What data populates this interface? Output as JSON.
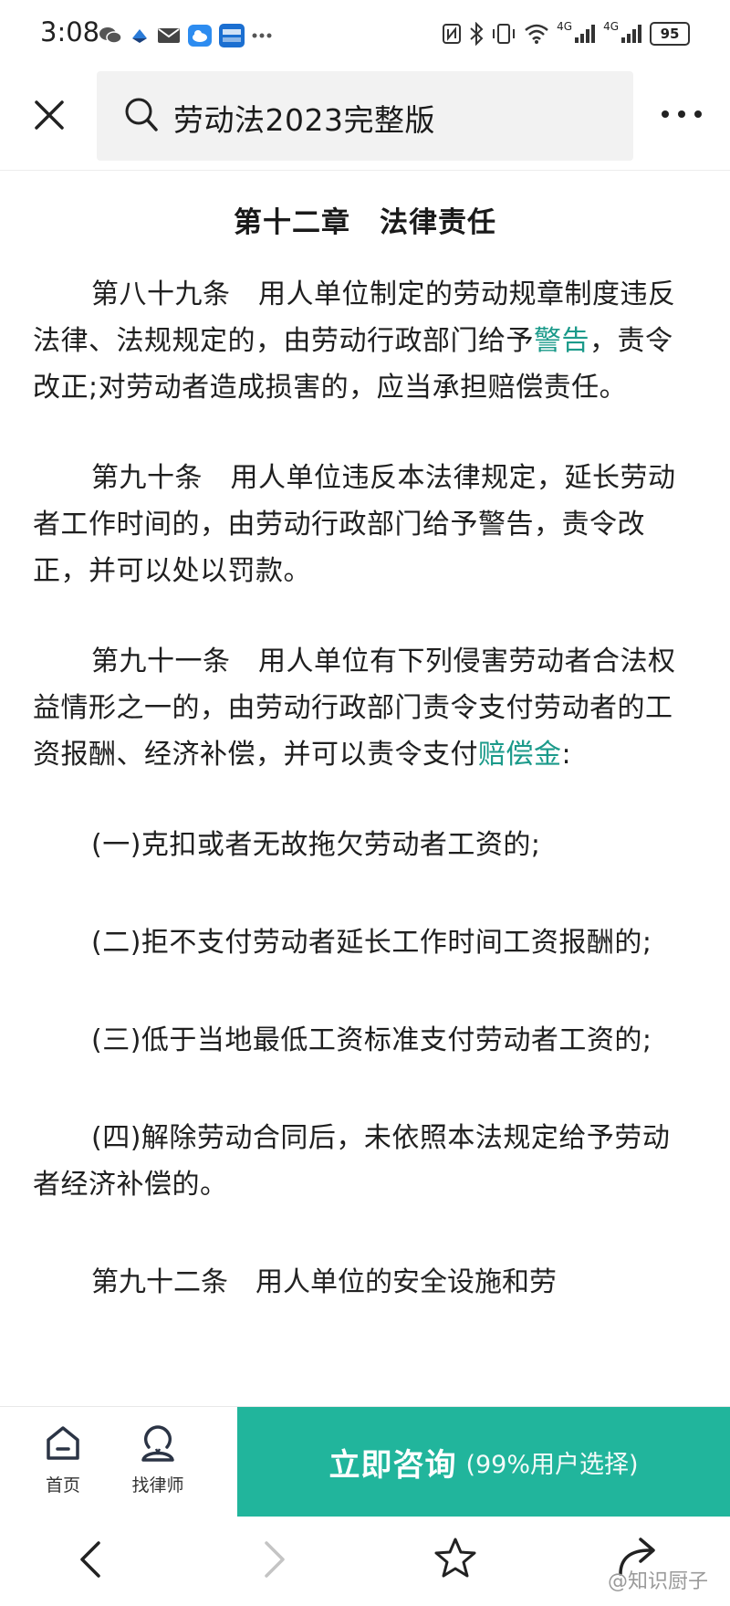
{
  "status_bar": {
    "time": "3:08",
    "left_icons": [
      "wechat-icon",
      "app-icon",
      "mail-icon",
      "cloud-icon",
      "app-icon"
    ],
    "right_icons": [
      "nfc-icon",
      "bluetooth-icon",
      "vibrate-icon",
      "wifi-icon",
      "signal-4g-icon",
      "signal-4g-icon"
    ],
    "network_label_1": "4G",
    "network_label_2": "4G",
    "battery": "95"
  },
  "header": {
    "search_text": "劳动法2023完整版"
  },
  "article": {
    "chapter_title": "第十二章　法律责任",
    "paragraphs": [
      {
        "before": "第八十九条　用人单位制定的劳动规章制度违反法律、法规规定的，由劳动行政部门给予",
        "link": "警告",
        "after": "，责令改正;对劳动者造成损害的，应当承担赔偿责任。"
      },
      {
        "text": "第九十条　用人单位违反本法律规定，延长劳动者工作时间的，由劳动行政部门给予警告，责令改正，并可以处以罚款。"
      },
      {
        "before": "第九十一条　用人单位有下列侵害劳动者合法权益情形之一的，由劳动行政部门责令支付劳动者的工资报酬、经济补偿，并可以责令支付",
        "link": "赔偿金",
        "after": ":"
      },
      {
        "text": "(一)克扣或者无故拖欠劳动者工资的;"
      },
      {
        "text": "(二)拒不支付劳动者延长工作时间工资报酬的;"
      },
      {
        "text": "(三)低于当地最低工资标准支付劳动者工资的;"
      },
      {
        "text": "(四)解除劳动合同后，未依照本法规定给予劳动者经济补偿的。"
      }
    ],
    "cut_line": "第九十二条　用人单位的安全设施和劳"
  },
  "bottom_bar": {
    "home_label": "首页",
    "lawyer_label": "找律师",
    "consult_main": "立即咨询",
    "consult_sub": "(99%用户选择)"
  },
  "browser_bar": {
    "watermark": "@知识厨子"
  },
  "colors": {
    "link": "#1b9a8a",
    "consult_bg": "#21b59c"
  }
}
